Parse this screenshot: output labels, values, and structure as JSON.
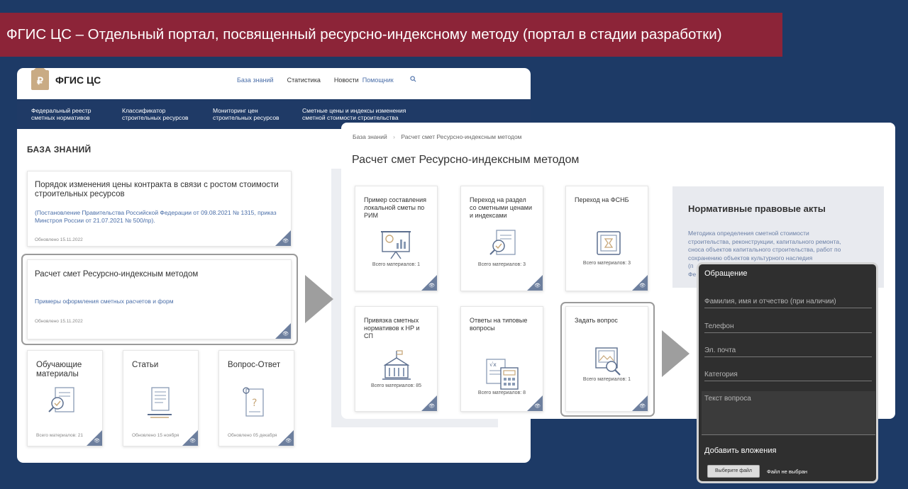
{
  "slide": {
    "banner": "ФГИС ЦС – Отдельный портал, посвященный ресурсно-индексному методу (портал в стадии разработки)"
  },
  "portal": {
    "logo_symbol": "₽",
    "brand": "ФГИС ЦС",
    "top_nav": [
      "База знаний",
      "Статистика",
      "Новости",
      "Помощник"
    ],
    "menu": [
      {
        "line1": "Федеральный реестр",
        "line2": "сметных нормативов"
      },
      {
        "line1": "Классификатор",
        "line2": "строительных ресурсов"
      },
      {
        "line1": "Мониторинг цен",
        "line2": "строительных ресурсов"
      },
      {
        "line1": "Сметные цены и индексы изменения",
        "line2": "сметной стоимости строительства"
      }
    ],
    "section_title": "БАЗА ЗНАНИЙ",
    "cards": [
      {
        "title_line1": "Порядок изменения цены контракта в связи с ростом стоимости",
        "title_line2": "строительных ресурсов",
        "link_line1": "(Постановление Правительства Российской Федерации от 09.08.2021 № 1315, приказ",
        "link_line2": "Минстроя России от 21.07.2021 № 500/пр).",
        "updated": "Обновлено 15.11.2022"
      },
      {
        "title": "Расчет смет Ресурсно-индексным методом",
        "link": "Примеры оформления сметных расчетов и форм",
        "updated": "Обновлено 15.11.2022"
      }
    ],
    "small_cards": [
      {
        "title_line1": "Обучающие",
        "title_line2": "материалы",
        "meta": "Всего материалов: 21"
      },
      {
        "title_line1": "Статьи",
        "title_line2": "",
        "meta": "Обновлено 15 ноября"
      },
      {
        "title_line1": "Вопрос-Ответ",
        "title_line2": "",
        "meta": "Обновлено 05 декабря"
      }
    ]
  },
  "method_page": {
    "breadcrumb_home": "База знаний",
    "breadcrumb_sep": "›",
    "breadcrumb_current": "Расчет смет Ресурсно-индексным методом",
    "title": "Расчет смет Ресурсно-индексным методом",
    "tiles": [
      {
        "l1": "Пример составления",
        "l2": "локальной сметы по",
        "l3": "РИМ",
        "meta": "Всего материалов: 1",
        "icon": "presentation-icon"
      },
      {
        "l1": "Переход на раздел",
        "l2": "со сметными ценами",
        "l3": "и индексами",
        "meta": "Всего материалов: 3",
        "icon": "document-check-icon"
      },
      {
        "l1": "Переход на ФСНБ",
        "l2": "",
        "l3": "",
        "meta": "Всего материалов: 3",
        "icon": "safe-icon"
      },
      {
        "l1": "Привязка сметных",
        "l2": "нормативов к НР и",
        "l3": "СП",
        "meta": "Всего материалов: 85",
        "icon": "building-icon"
      },
      {
        "l1": "Ответы на типовые",
        "l2": "вопросы",
        "l3": "",
        "meta": "Всего материалов: 8",
        "icon": "calculator-icon"
      },
      {
        "l1": "Задать вопрос",
        "l2": "",
        "l3": "",
        "meta": "Всего материалов: 1",
        "icon": "search-image-icon"
      }
    ],
    "npa": {
      "title": "Нормативные правовые акты",
      "text_line1": "Методика определения сметной стоимости",
      "text_line2": "строительства, реконструкции, капитального ремонта,",
      "text_line3": "сноса объектов капитального строительства, работ по",
      "text_line4": "сохранению объектов культурного наследия",
      "text_line5": "(п",
      "text_line6": "Фе"
    }
  },
  "form": {
    "title": "Обращение",
    "fields": [
      "Фамилия, имя и отчество (при наличии)",
      "Телефон",
      "Эл. почта",
      "Категория"
    ],
    "textarea_placeholder": "Текст вопроса",
    "attach_label": "Добавить вложения",
    "file_button": "Выберите файл",
    "no_file": "Файл не выбран"
  },
  "colors": {
    "background": "#1d3a66",
    "banner": "#8c2438",
    "nav_bar": "#1f3a66",
    "corner_badge": "#6d7f9e",
    "link": "#4a6ea8"
  }
}
